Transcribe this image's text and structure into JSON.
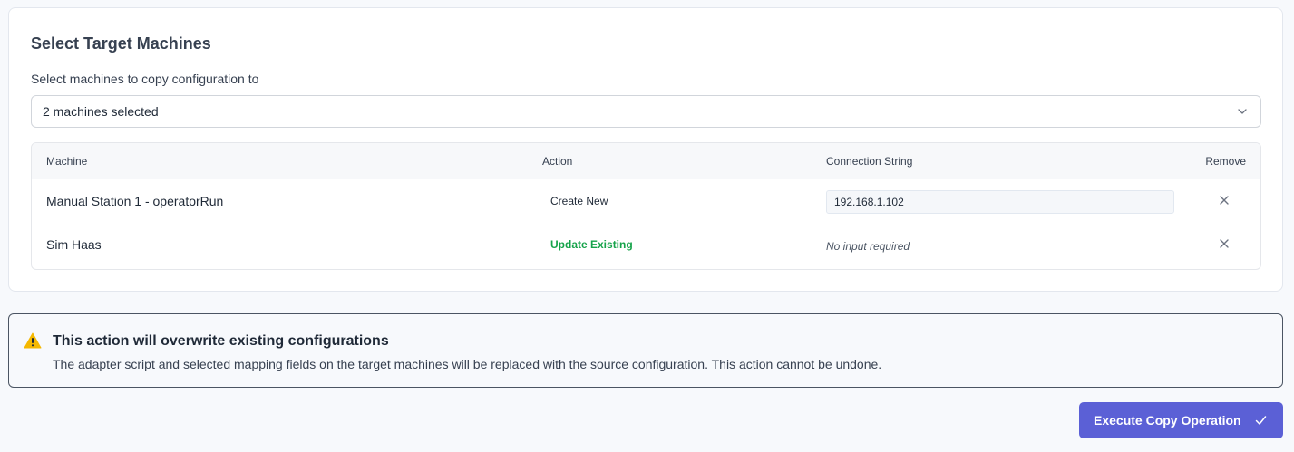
{
  "card": {
    "title": "Select Target Machines",
    "select_label": "Select machines to copy configuration to",
    "select_value": "2 machines selected"
  },
  "table": {
    "headers": {
      "machine": "Machine",
      "action": "Action",
      "connection": "Connection String",
      "remove": "Remove"
    },
    "rows": [
      {
        "machine": "Manual Station 1 - operatorRun",
        "action": "Create New",
        "connection_value": "192.168.1.102"
      },
      {
        "machine": "Sim Haas",
        "action": "Update Existing",
        "connection_note": "No input required"
      }
    ]
  },
  "alert": {
    "title": "This action will overwrite existing configurations",
    "body": "The adapter script and selected mapping fields on the target machines will be replaced with the source configuration. This action cannot be undone."
  },
  "footer": {
    "execute_label": "Execute Copy Operation"
  },
  "colors": {
    "primary": "#5b60d6",
    "success": "#16a34a",
    "warning": "#f5b800"
  },
  "icons": {
    "dropdown": "chevron-down-icon",
    "remove": "close-icon",
    "warning": "warning-icon",
    "submit": "check-icon"
  }
}
